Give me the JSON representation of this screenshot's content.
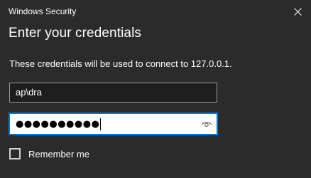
{
  "window": {
    "title": "Windows Security"
  },
  "dialog": {
    "heading": "Enter your credentials",
    "message": "These credentials will be used to connect to 127.0.0.1."
  },
  "form": {
    "username_value": "ap\\dra",
    "password_mask": "●●●●●●●●●●",
    "remember_label": "Remember me",
    "remember_checked": false
  },
  "icons": {
    "close": "close-icon",
    "reveal": "eye-icon"
  },
  "colors": {
    "background": "#2b2b2b",
    "accent": "#0078d7"
  }
}
